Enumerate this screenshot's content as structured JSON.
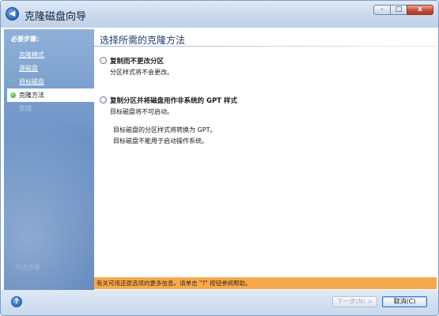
{
  "window": {
    "title": "克隆磁盘向导",
    "back_icon": "back-arrow-icon",
    "caption_buttons": [
      "minimize",
      "maximize",
      "close"
    ],
    "close_glyph": "x",
    "minimize_glyph": "-",
    "maximize_glyph": "□"
  },
  "sidebar": {
    "heading": "必要步骤:",
    "items": [
      {
        "label": "克隆模式",
        "state": "done"
      },
      {
        "label": "源磁盘",
        "state": "done"
      },
      {
        "label": "目标磁盘",
        "state": "done"
      },
      {
        "label": "克隆方法",
        "state": "current"
      },
      {
        "label": "完成",
        "state": "disabled"
      }
    ],
    "check_glyph": "✓",
    "faint_text": "可选步骤"
  },
  "main": {
    "title": "选择所需的克隆方法",
    "option1": {
      "label": "复制而不更改分区",
      "description": "分区样式将不会更改。",
      "selected": false
    },
    "option2": {
      "label": "复制分区并将磁盘用作非系统的 GPT 样式",
      "description": "目标磁盘将不可启动。",
      "note1": "目标磁盘的分区样式将转换为 GPT。",
      "note2": "目标磁盘不能用于启动操作系统。",
      "selected": false
    }
  },
  "info_bar": {
    "text": "有关可用还原选项的更多信息，请单击 \"?\" 按钮参阅帮助。",
    "color": "#f6a94c"
  },
  "footer": {
    "help_glyph": "?",
    "next_label": "下一步(N) >",
    "cancel_label": "取消(C)"
  },
  "colors": {
    "sidebar": "#6e94c6",
    "accent": "#1f3a6e",
    "check": "#6ee05a"
  }
}
